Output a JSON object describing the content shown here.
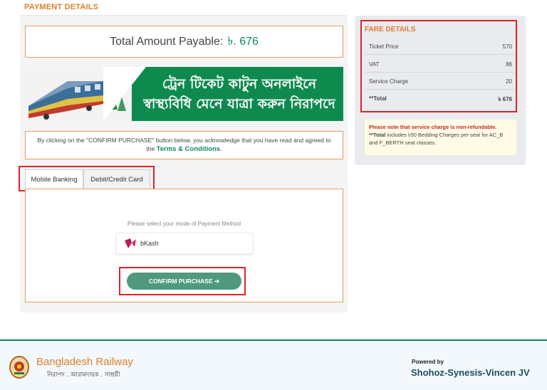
{
  "payment": {
    "section_title": "PAYMENT DETAILS",
    "total_label": "Total Amount Payable:",
    "total_value": "৳. 676",
    "banner_line1": "ট্রেন টিকেট কাটুন অনলাইনে",
    "banner_line2": "স্বাস্থ্যবিধি মেনে যাত্রা করুন নিরাপদে",
    "terms_text": "By clicking on the \"CONFIRM PURCHASE\" button below, you acknowledge that you have read and agreed to the",
    "terms_link": "Terms & Conditions",
    "terms_end": ".",
    "tabs": [
      {
        "label": "Mobile Banking",
        "active": true
      },
      {
        "label": "Debit/Credit Card",
        "active": false
      }
    ],
    "method_hint": "Please select your mode of Payment Method",
    "method_option": "bKash",
    "confirm_label": "CONFIRM PURCHASE ➔"
  },
  "fare": {
    "title": "FARE DETAILS",
    "rows": [
      {
        "label": "Ticket Price",
        "value": "570"
      },
      {
        "label": "VAT",
        "value": "86"
      },
      {
        "label": "Service Charge",
        "value": "20"
      },
      {
        "label": "**Total",
        "value": "৳ 676"
      }
    ],
    "note_red": "Please note that service charge is non-refundable.",
    "note_total_prefix": "**Total",
    "note_rest": " includes ৳50 Bedding Charges per seat for AC_B and F_BERTH seat classes."
  },
  "footer": {
    "org_name": "Bangladesh Railway",
    "org_tagline": "নিরাপদ . আরামদায়ক . সাশ্রয়ী",
    "powered_by": "Powered by",
    "partner": "Shohoz-Synesis-Vincen JV"
  },
  "colors": {
    "accent_orange": "#d9822b",
    "brand_green": "#0e8a5a",
    "highlight_red": "#d7262b",
    "button_green": "#4f9a7d"
  }
}
